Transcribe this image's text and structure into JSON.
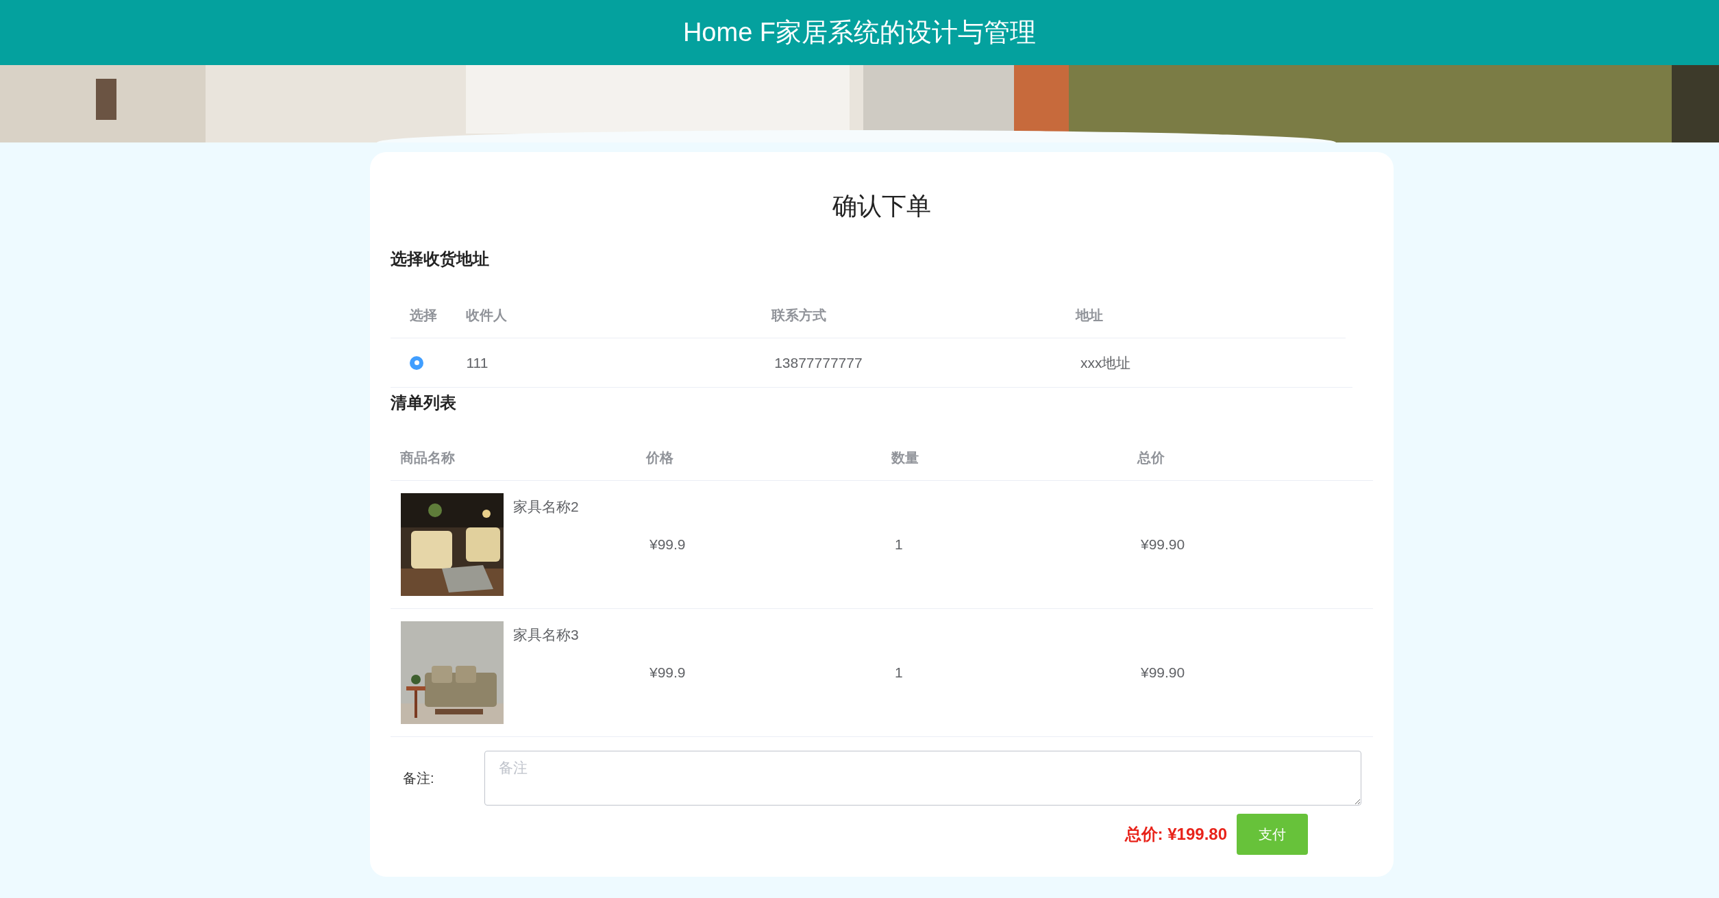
{
  "header": {
    "title": "Home F家居系统的设计与管理"
  },
  "page_title": "确认下单",
  "address_section": {
    "title": "选择收货地址",
    "columns": [
      "选择",
      "收件人",
      "联系方式",
      "地址"
    ],
    "rows": [
      {
        "selected": true,
        "recipient": "111",
        "phone": "13877777777",
        "address": "xxx地址"
      }
    ]
  },
  "list_section": {
    "title": "清单列表",
    "columns": [
      "商品名称",
      "价格",
      "数量",
      "总价"
    ],
    "rows": [
      {
        "name": "家具名称2",
        "price": "¥99.9",
        "quantity": "1",
        "total": "¥99.90"
      },
      {
        "name": "家具名称3",
        "price": "¥99.9",
        "quantity": "1",
        "total": "¥99.90"
      }
    ]
  },
  "remarks": {
    "label": "备注:",
    "placeholder": "备注"
  },
  "total": {
    "label": "总价:",
    "value": "¥199.80"
  },
  "pay_button": "支付"
}
